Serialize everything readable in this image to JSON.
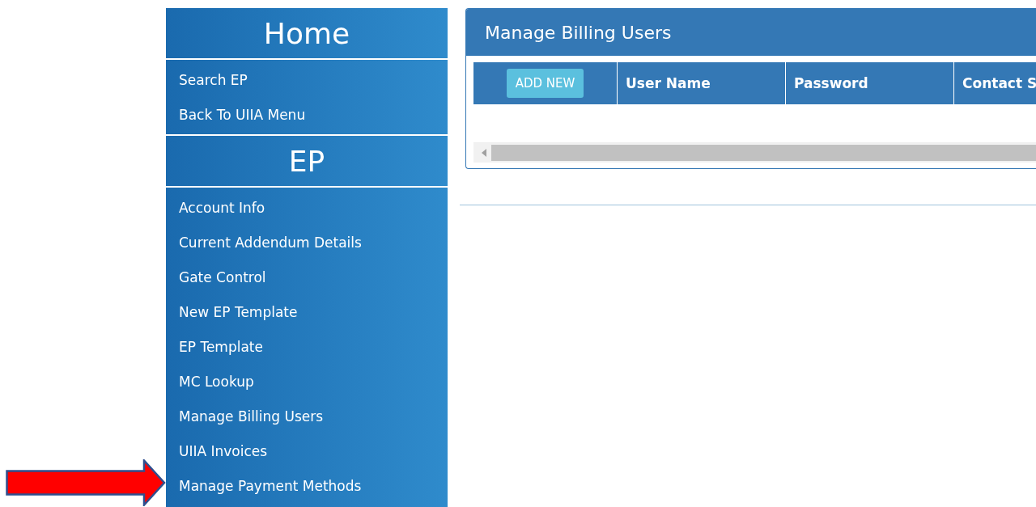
{
  "sidebar": {
    "sections": [
      {
        "title": "Home",
        "items": [
          {
            "label": "Search EP"
          },
          {
            "label": "Back To UIIA Menu"
          }
        ]
      },
      {
        "title": "EP",
        "items": [
          {
            "label": "Account Info"
          },
          {
            "label": "Current Addendum Details"
          },
          {
            "label": "Gate Control"
          },
          {
            "label": "New EP Template"
          },
          {
            "label": "EP Template"
          },
          {
            "label": "MC Lookup"
          },
          {
            "label": "Manage Billing Users"
          },
          {
            "label": "UIIA Invoices"
          },
          {
            "label": "Manage Payment Methods"
          }
        ]
      }
    ]
  },
  "panel": {
    "title": "Manage Billing Users",
    "add_button": "ADD NEW",
    "columns": [
      "User Name",
      "Password",
      "Contact S"
    ]
  }
}
